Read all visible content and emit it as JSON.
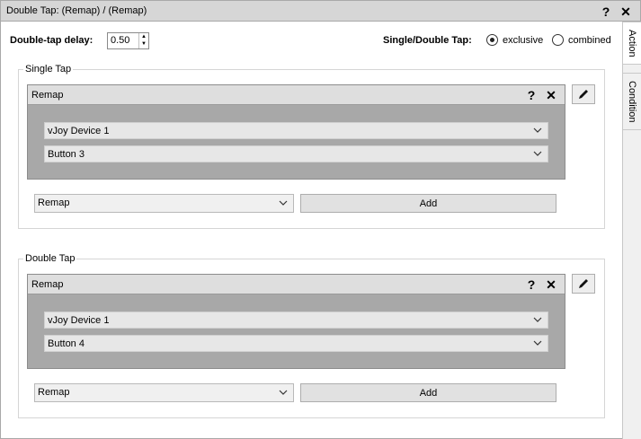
{
  "window": {
    "title": "Double Tap: (Remap) / (Remap)",
    "help_glyph": "?",
    "close_glyph": "✕"
  },
  "side_tabs": {
    "action": "Action",
    "condition": "Condition"
  },
  "settings": {
    "delay_label": "Double-tap delay:",
    "delay_value": "0.50",
    "mode_label": "Single/Double Tap:",
    "option_exclusive": "exclusive",
    "option_combined": "combined",
    "selected_mode": "exclusive"
  },
  "single_tap": {
    "group_label": "Single Tap",
    "action_title": "Remap",
    "device": "vJoy Device 1",
    "input": "Button 3",
    "add_action_type": "Remap",
    "add_label": "Add"
  },
  "double_tap": {
    "group_label": "Double Tap",
    "action_title": "Remap",
    "device": "vJoy Device 1",
    "input": "Button 4",
    "add_action_type": "Remap",
    "add_label": "Add"
  },
  "icons": {
    "help": "?",
    "close": "✕",
    "chevron": "⌵",
    "edit": "pencil-icon"
  }
}
